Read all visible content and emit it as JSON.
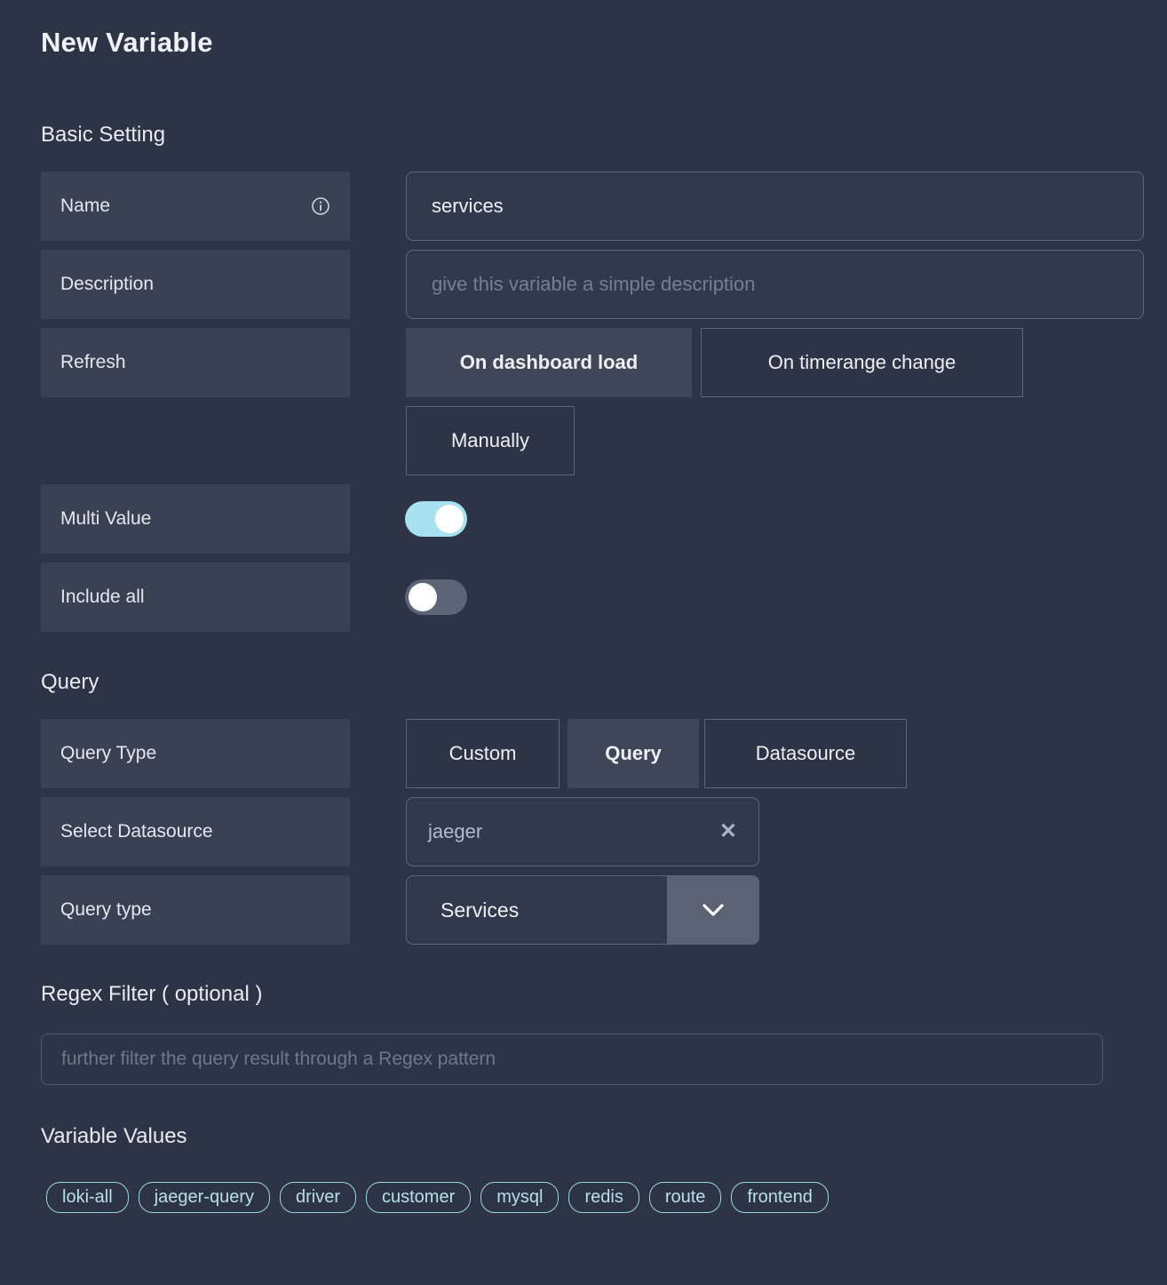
{
  "page": {
    "title": "New Variable"
  },
  "sections": {
    "basic": "Basic Setting",
    "query": "Query",
    "regex": "Regex Filter ( optional )",
    "values": "Variable Values"
  },
  "basic": {
    "name": {
      "label": "Name",
      "info_icon": "info-icon",
      "value": "services"
    },
    "description": {
      "label": "Description",
      "value": "",
      "placeholder": "give this variable a simple description"
    },
    "refresh": {
      "label": "Refresh",
      "options": [
        {
          "label": "On dashboard load",
          "selected": true
        },
        {
          "label": "On timerange change",
          "selected": false
        },
        {
          "label": "Manually",
          "selected": false
        }
      ]
    },
    "multi_value": {
      "label": "Multi Value",
      "state": "on"
    },
    "include_all": {
      "label": "Include all",
      "state": "off"
    }
  },
  "query": {
    "query_type": {
      "label": "Query Type",
      "options": [
        {
          "label": "Custom",
          "selected": false
        },
        {
          "label": "Query",
          "selected": true
        },
        {
          "label": "Datasource",
          "selected": false
        }
      ]
    },
    "select_datasource": {
      "label": "Select Datasource",
      "value": "jaeger",
      "clear_icon": "close-icon"
    },
    "query_type_select": {
      "label": "Query type",
      "value": "Services",
      "caret_icon": "chevron-down-icon"
    }
  },
  "regex": {
    "value": "",
    "placeholder": "further filter the query result through a Regex pattern"
  },
  "variable_values": [
    "loki-all",
    "jaeger-query",
    "driver",
    "customer",
    "mysql",
    "redis",
    "route",
    "frontend"
  ],
  "colors": {
    "background": "#2d3445",
    "label_bg": "#3a4152",
    "input_bg": "#313a4d",
    "border": "#5c667b",
    "selected_bg": "#3e4657",
    "toggle_on": "#a9e1f0",
    "toggle_off": "#5d6475",
    "chip_accent": "#9ed5e4",
    "text_primary": "#edf0f5",
    "text_muted": "#767f92"
  }
}
